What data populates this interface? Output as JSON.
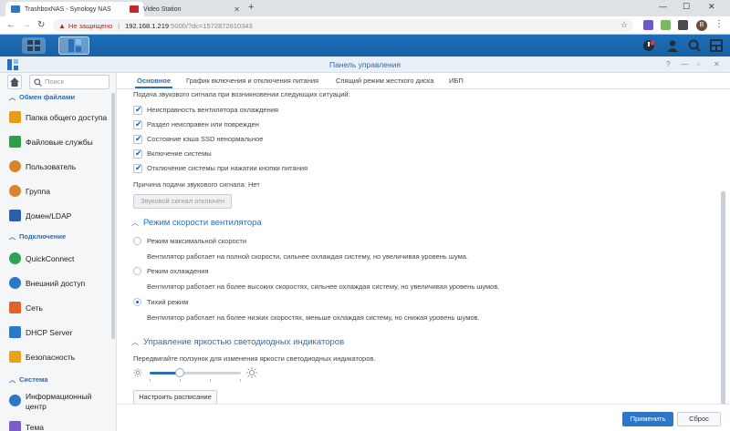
{
  "browser": {
    "tabs": [
      {
        "title": "TrashboxNAS - Synology NAS",
        "active": true,
        "favicon_color": "#2d77c8"
      },
      {
        "title": "Video Station",
        "active": false,
        "favicon_color": "#c62828"
      }
    ],
    "address": {
      "warning": "Не защищено",
      "url_host": "192.168.1.219",
      "url_rest": ":5000/?dc=1572872610343"
    },
    "profile_initial": "B"
  },
  "window": {
    "title": "Панель управления"
  },
  "sidebar": {
    "search_placeholder": "Поиск",
    "categories": [
      {
        "label": "Обмен файлами"
      },
      {
        "label": "Подключение"
      },
      {
        "label": "Система"
      }
    ],
    "items": [
      {
        "label": "Папка общего доступа",
        "color": "#e89a1c"
      },
      {
        "label": "Файловые службы",
        "color": "#2e9d48"
      },
      {
        "label": "Пользователь",
        "color": "#d9842a"
      },
      {
        "label": "Группа",
        "color": "#d9842a"
      },
      {
        "label": "Домен/LDAP",
        "color": "#2d5fa8"
      },
      {
        "label": "QuickConnect",
        "color": "#2ea44f"
      },
      {
        "label": "Внешний доступ",
        "color": "#2d77c8"
      },
      {
        "label": "Сеть",
        "color": "#e0622a"
      },
      {
        "label": "DHCP Server",
        "color": "#2d77c8"
      },
      {
        "label": "Безопасность",
        "color": "#e8a21c"
      },
      {
        "label": "Информационный",
        "label2": "центр",
        "color": "#2d77c8"
      },
      {
        "label": "Тема",
        "color": "#7b5cc9"
      }
    ]
  },
  "tabs": [
    {
      "label": "Основное",
      "active": true
    },
    {
      "label": "График включения и отключения питания",
      "active": false
    },
    {
      "label": "Спящий режим жесткого диска",
      "active": false
    },
    {
      "label": "ИБП",
      "active": false
    }
  ],
  "beep": {
    "intro": "Подача звукового сигнала при возникновении следующих ситуаций:",
    "options": [
      {
        "label": "Неисправность вентилятора охлаждения",
        "checked": true
      },
      {
        "label": "Раздел неисправен или поврежден",
        "checked": true
      },
      {
        "label": "Состояние кэша SSD ненормальное",
        "checked": true
      },
      {
        "label": "Включение системы",
        "checked": true
      },
      {
        "label": "Отключение системы при нажатии кнопки питания",
        "checked": true
      }
    ],
    "reason": "Причина подачи звукового сигнала: Нет",
    "off_button": "Звуковой сигнал отключен"
  },
  "fan": {
    "title": "Режим скорости вентилятора",
    "modes": [
      {
        "label": "Режим максимальной скорости",
        "desc": "Вентилятор работает на полной скорости, сильнее охлаждая систему, но увеличивая уровень шума.",
        "selected": false
      },
      {
        "label": "Режим охлаждения",
        "desc": "Вентилятор работает на более высоких скоростях, сильнее охлаждая систему, но увеличивая уровень шумов.",
        "selected": false
      },
      {
        "label": "Тихий режим",
        "desc": "Вентилятор работает на более низких скоростях, меньше охлаждая систему, но снижая уровень шумов.",
        "selected": true
      }
    ]
  },
  "led": {
    "title": "Управление яркостью светодиодных индикаторов",
    "hint": "Передвигайте ползунок для изменения яркости светодиодных индикаторов.",
    "brightness_level": 0.33,
    "schedule_button": "Настроить расписание"
  },
  "footer": {
    "apply": "Применить",
    "reset": "Сброс"
  }
}
